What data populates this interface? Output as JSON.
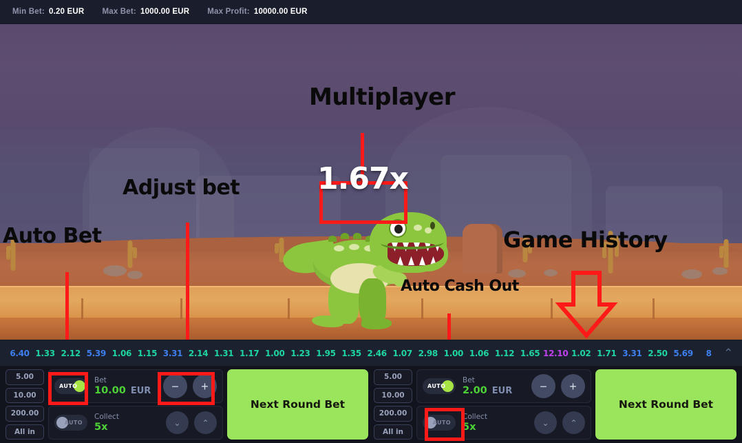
{
  "topbar": {
    "items": [
      {
        "label": "Min Bet:",
        "value": "0.20 EUR"
      },
      {
        "label": "Max Bet:",
        "value": "1000.00 EUR"
      },
      {
        "label": "Max Profit:",
        "value": "10000.00 EUR"
      }
    ]
  },
  "game": {
    "multiplier": "1.67x",
    "character": "dinosaur"
  },
  "annotations": [
    {
      "id": "auto-bet",
      "text": "Auto Bet"
    },
    {
      "id": "adjust-bet",
      "text": "Adjust bet"
    },
    {
      "id": "multiplayer",
      "text": "Multiplayer"
    },
    {
      "id": "auto-cash-out",
      "text": "Auto Cash Out"
    },
    {
      "id": "game-history",
      "text": "Game History"
    }
  ],
  "history": {
    "entries": [
      {
        "value": "6.40",
        "color": "blue"
      },
      {
        "value": "1.33",
        "color": "green"
      },
      {
        "value": "2.12",
        "color": "green"
      },
      {
        "value": "5.39",
        "color": "blue"
      },
      {
        "value": "1.06",
        "color": "green"
      },
      {
        "value": "1.15",
        "color": "green"
      },
      {
        "value": "3.31",
        "color": "blue"
      },
      {
        "value": "2.14",
        "color": "green"
      },
      {
        "value": "1.31",
        "color": "green"
      },
      {
        "value": "1.17",
        "color": "green"
      },
      {
        "value": "1.00",
        "color": "green"
      },
      {
        "value": "1.23",
        "color": "green"
      },
      {
        "value": "1.95",
        "color": "green"
      },
      {
        "value": "1.35",
        "color": "green"
      },
      {
        "value": "2.46",
        "color": "green"
      },
      {
        "value": "1.07",
        "color": "green"
      },
      {
        "value": "2.98",
        "color": "green"
      },
      {
        "value": "1.00",
        "color": "green"
      },
      {
        "value": "1.06",
        "color": "green"
      },
      {
        "value": "1.12",
        "color": "green"
      },
      {
        "value": "1.65",
        "color": "green"
      },
      {
        "value": "12.10",
        "color": "purple"
      },
      {
        "value": "1.02",
        "color": "green"
      },
      {
        "value": "1.71",
        "color": "green"
      },
      {
        "value": "3.31",
        "color": "blue"
      },
      {
        "value": "2.50",
        "color": "green"
      },
      {
        "value": "5.69",
        "color": "blue"
      },
      {
        "value": "8",
        "color": "blue"
      }
    ],
    "expand_icon": "chevron-up-icon"
  },
  "panels": [
    {
      "id": "left",
      "quick_bets": [
        "5.00",
        "10.00",
        "200.00",
        "All in"
      ],
      "bet": {
        "auto_label": "AUTO",
        "auto_on": true,
        "label": "Bet",
        "amount": "10.00",
        "currency": "EUR",
        "minus": "−",
        "plus": "+"
      },
      "collect": {
        "auto_label": "AUTO",
        "auto_on": false,
        "label": "Collect",
        "amount": "5x",
        "down": "⌄",
        "up": "⌃"
      },
      "action_button": "Next Round Bet"
    },
    {
      "id": "right",
      "quick_bets": [
        "5.00",
        "10.00",
        "200.00",
        "All in"
      ],
      "bet": {
        "auto_label": "AUTO",
        "auto_on": true,
        "label": "Bet",
        "amount": "2.00",
        "currency": "EUR",
        "minus": "−",
        "plus": "+"
      },
      "collect": {
        "auto_label": "AUTO",
        "auto_on": false,
        "label": "Collect",
        "amount": "5x",
        "down": "⌄",
        "up": "⌃"
      },
      "action_button": "Next Round Bet"
    }
  ],
  "colors": {
    "annotation_red": "#ff1a1a",
    "bet_button_green": "#9ae55c",
    "amount_green": "#4cd137",
    "history_blue": "#3d7ff0",
    "history_green": "#1ed4a0",
    "history_purple": "#c040ef"
  }
}
